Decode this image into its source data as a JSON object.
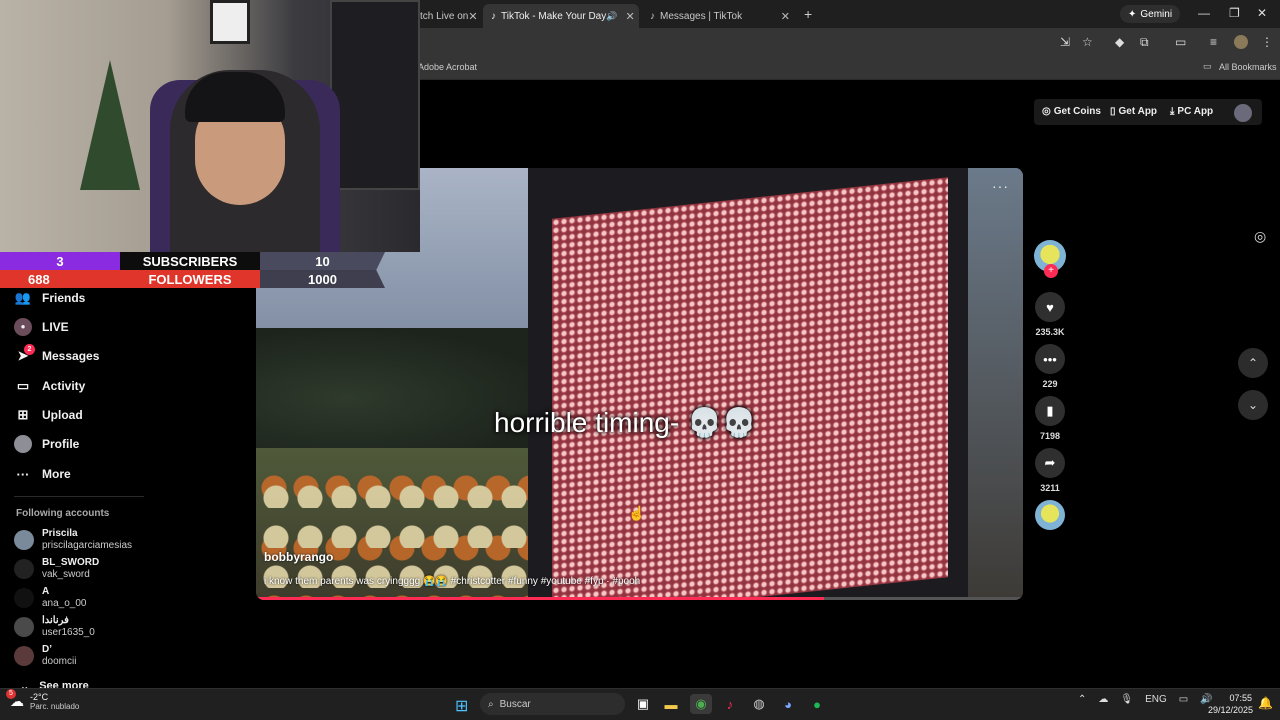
{
  "browser": {
    "tabs": [
      {
        "label": "tch Live on"
      },
      {
        "label": "TikTok - Make Your Day"
      },
      {
        "label": "Messages | TikTok"
      }
    ],
    "gemini_label": "Gemini",
    "bookmark_item": "Adobe Acrobat",
    "all_bookmarks": "All Bookmarks"
  },
  "header": {
    "get_coins": "Get Coins",
    "get_app": "Get App",
    "pc_app": "PC App"
  },
  "stream_stats": {
    "subscribers_count": "3",
    "subscribers_label": "SUBSCRIBERS",
    "subscribers_goal": "10",
    "followers_count": "688",
    "followers_label": "FOLLOWERS",
    "followers_goal": "1000"
  },
  "sidebar": {
    "items": [
      {
        "label": "Friends",
        "icon": "friends-icon"
      },
      {
        "label": "LIVE",
        "icon": "live-icon"
      },
      {
        "label": "Messages",
        "icon": "messages-icon",
        "badge": "2"
      },
      {
        "label": "Activity",
        "icon": "activity-icon"
      },
      {
        "label": "Upload",
        "icon": "upload-icon"
      },
      {
        "label": "Profile",
        "icon": "profile-icon"
      },
      {
        "label": "More",
        "icon": "more-icon"
      }
    ],
    "following_title": "Following accounts",
    "accounts": [
      {
        "name": "Priscila",
        "username": "priscilagarciamesias"
      },
      {
        "name": "BL_SWORD",
        "username": "vak_sword"
      },
      {
        "name": "A",
        "username": "ana_o_00"
      },
      {
        "name": "فرناندا",
        "username": "user1635_0"
      },
      {
        "name": "D’",
        "username": "doomcii"
      }
    ],
    "see_more": "See more"
  },
  "video": {
    "overlay_text": "horrible timing- 💀💀",
    "author": "bobbyrango",
    "description": "i know them parents was cryingggg 😭😭 #christcotter #funny #youtube #fyp · #pooh",
    "progress": 0.74
  },
  "actions": {
    "likes": "235.3K",
    "comments": "229",
    "saves": "7198",
    "shares": "3211"
  },
  "taskbar": {
    "temperature": "-2°C",
    "weather": "Parc. nublado",
    "weather_badge": "5",
    "search_placeholder": "Buscar",
    "language": "ENG",
    "time": "07:55",
    "date": "29/12/2025"
  }
}
